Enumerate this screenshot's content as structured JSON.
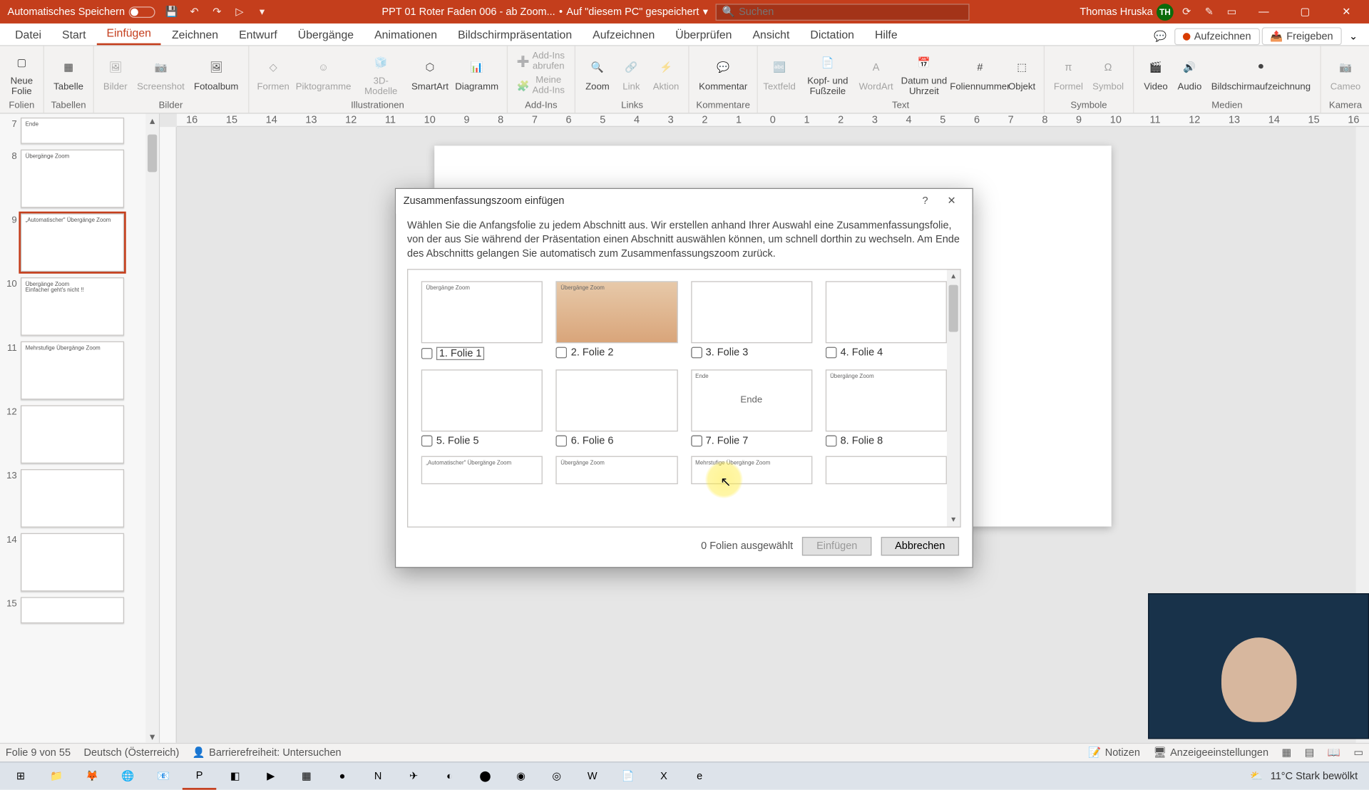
{
  "titlebar": {
    "autosave": "Automatisches Speichern",
    "doc": "PPT 01 Roter Faden 006 - ab Zoom...",
    "saved_sep": "•",
    "saved": "Auf \"diesem PC\" gespeichert",
    "search_placeholder": "Suchen",
    "user": "Thomas Hruska",
    "initials": "TH"
  },
  "tabs": [
    "Datei",
    "Start",
    "Einfügen",
    "Zeichnen",
    "Entwurf",
    "Übergänge",
    "Animationen",
    "Bildschirmpräsentation",
    "Aufzeichnen",
    "Überprüfen",
    "Ansicht",
    "Dictation",
    "Hilfe"
  ],
  "tabs_active": 2,
  "ribbon_right": {
    "record": "Aufzeichnen",
    "share": "Freigeben"
  },
  "ribbon": {
    "groups": [
      {
        "label": "Folien",
        "items": [
          {
            "l": "Neue Folie"
          }
        ]
      },
      {
        "label": "Tabellen",
        "items": [
          {
            "l": "Tabelle"
          }
        ]
      },
      {
        "label": "Bilder",
        "items": [
          {
            "l": "Bilder",
            "d": true
          },
          {
            "l": "Screenshot",
            "d": true
          },
          {
            "l": "Fotoalbum"
          }
        ]
      },
      {
        "label": "Illustrationen",
        "items": [
          {
            "l": "Formen",
            "d": true
          },
          {
            "l": "Piktogramme",
            "d": true
          },
          {
            "l": "3D-Modelle",
            "d": true
          },
          {
            "l": "SmartArt"
          },
          {
            "l": "Diagramm"
          }
        ]
      },
      {
        "label": "Add-Ins",
        "items": [
          {
            "l": "Add-Ins abrufen",
            "d": true,
            "small": true
          },
          {
            "l": "Meine Add-Ins",
            "d": true,
            "small": true
          }
        ]
      },
      {
        "label": "Links",
        "items": [
          {
            "l": "Zoom"
          },
          {
            "l": "Link",
            "d": true
          },
          {
            "l": "Aktion",
            "d": true
          }
        ]
      },
      {
        "label": "Kommentare",
        "items": [
          {
            "l": "Kommentar"
          }
        ]
      },
      {
        "label": "Text",
        "items": [
          {
            "l": "Textfeld",
            "d": true
          },
          {
            "l": "Kopf- und Fußzeile"
          },
          {
            "l": "WordArt",
            "d": true
          },
          {
            "l": "Datum und Uhrzeit"
          },
          {
            "l": "Foliennummer"
          },
          {
            "l": "Objekt"
          }
        ]
      },
      {
        "label": "Symbole",
        "items": [
          {
            "l": "Formel",
            "d": true
          },
          {
            "l": "Symbol",
            "d": true
          }
        ]
      },
      {
        "label": "Medien",
        "items": [
          {
            "l": "Video"
          },
          {
            "l": "Audio"
          },
          {
            "l": "Bildschirmaufzeichnung"
          }
        ]
      },
      {
        "label": "Kamera",
        "items": [
          {
            "l": "Cameo",
            "d": true
          }
        ]
      }
    ]
  },
  "thumbs": [
    {
      "n": 7,
      "txt": "Ende",
      "short": true
    },
    {
      "n": 8,
      "txt": "Übergänge Zoom"
    },
    {
      "n": 9,
      "txt": "„Automatischer\" Übergänge Zoom",
      "sel": true
    },
    {
      "n": 10,
      "txt": "Übergänge Zoom\nEinfacher geht's nicht !!"
    },
    {
      "n": 11,
      "txt": "Mehrstufige Übergänge Zoom"
    },
    {
      "n": 12,
      "txt": ""
    },
    {
      "n": 13,
      "txt": ""
    },
    {
      "n": 14,
      "txt": ""
    },
    {
      "n": 15,
      "txt": "",
      "short": true
    }
  ],
  "ruler": [
    "16",
    "15",
    "14",
    "13",
    "12",
    "11",
    "10",
    "9",
    "8",
    "7",
    "6",
    "5",
    "4",
    "3",
    "2",
    "1",
    "0",
    "1",
    "2",
    "3",
    "4",
    "5",
    "6",
    "7",
    "8",
    "9",
    "10",
    "11",
    "12",
    "13",
    "14",
    "15",
    "16"
  ],
  "dialog": {
    "title": "Zusammenfassungszoom einfügen",
    "desc": "Wählen Sie die Anfangsfolie zu jedem Abschnitt aus. Wir erstellen anhand Ihrer Auswahl eine Zusammenfassungsfolie, von der aus Sie während der Präsentation einen Abschnitt auswählen können, um schnell dorthin zu wechseln. Am Ende des Abschnitts gelangen Sie automatisch zum Zusammenfassungszoom zurück.",
    "items": [
      {
        "label": "1. Folie 1",
        "boxed": true,
        "txt": "Übergänge Zoom"
      },
      {
        "label": "2. Folie 2",
        "sun": true,
        "txt": "Übergänge Zoom"
      },
      {
        "label": "3. Folie 3",
        "txt": ""
      },
      {
        "label": "4. Folie 4",
        "txt": ""
      },
      {
        "label": "5. Folie 5",
        "txt": ""
      },
      {
        "label": "6. Folie 6",
        "txt": ""
      },
      {
        "label": "7. Folie 7",
        "txt": "Ende"
      },
      {
        "label": "8. Folie 8",
        "txt": "Übergänge Zoom"
      },
      {
        "label": "",
        "txt": "„Automatischer\" Übergänge Zoom",
        "partial": true
      },
      {
        "label": "",
        "txt": "Übergänge Zoom",
        "partial": true
      },
      {
        "label": "",
        "txt": "Mehrstufige Übergänge Zoom",
        "partial": true
      },
      {
        "label": "",
        "txt": "",
        "partial": true
      }
    ],
    "count": "0 Folien ausgewählt",
    "insert": "Einfügen",
    "cancel": "Abbrechen"
  },
  "status": {
    "slide": "Folie 9 von 55",
    "lang": "Deutsch (Österreich)",
    "access": "Barrierefreiheit: Untersuchen",
    "notes": "Notizen",
    "display": "Anzeigeeinstellungen"
  },
  "tray": {
    "weather": "11°C  Stark bewölkt"
  }
}
